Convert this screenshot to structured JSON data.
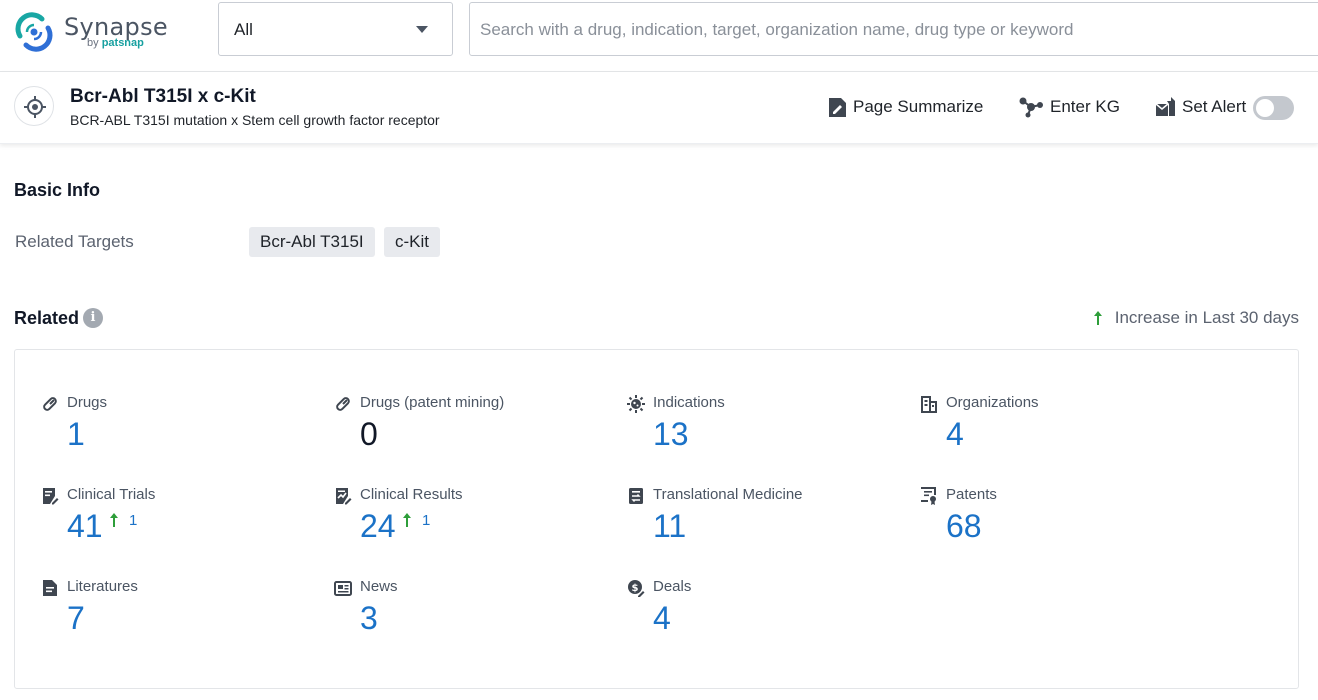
{
  "app": {
    "logo_name": "Synapse",
    "logo_by": "by",
    "logo_brand": "patsnap"
  },
  "search": {
    "scope_value": "All",
    "placeholder": "Search with a drug, indication, target, organization name, drug type or keyword"
  },
  "header": {
    "title": "Bcr-Abl T315I x c-Kit",
    "subtitle": "BCR-ABL T315I mutation x Stem cell growth factor receptor",
    "actions": {
      "summarize": "Page Summarize",
      "kg": "Enter KG",
      "alert": "Set Alert"
    },
    "alert_enabled": false
  },
  "basic_info": {
    "title": "Basic Info",
    "related_targets_label": "Related Targets",
    "targets": [
      "Bcr-Abl T315I",
      "c-Kit"
    ]
  },
  "related": {
    "title": "Related",
    "info_glyph": "i",
    "increase_legend": "Increase in Last 30 days",
    "increase_color": "#2e9e3a",
    "value_color": "#1b72c7",
    "stats": [
      {
        "label": "Drugs",
        "value": "1",
        "icon": "pill-icon"
      },
      {
        "label": "Drugs (patent mining)",
        "value": "0",
        "icon": "pill-icon"
      },
      {
        "label": "Indications",
        "value": "13",
        "icon": "virus-icon"
      },
      {
        "label": "Organizations",
        "value": "4",
        "icon": "building-icon"
      },
      {
        "label": "Clinical Trials",
        "value": "41",
        "increase": "1",
        "icon": "clinical-trial-icon"
      },
      {
        "label": "Clinical Results",
        "value": "24",
        "increase": "1",
        "icon": "clinical-result-icon"
      },
      {
        "label": "Translational Medicine",
        "value": "11",
        "icon": "translational-icon"
      },
      {
        "label": "Patents",
        "value": "68",
        "icon": "patent-icon"
      },
      {
        "label": "Literatures",
        "value": "7",
        "icon": "document-icon"
      },
      {
        "label": "News",
        "value": "3",
        "icon": "news-icon"
      },
      {
        "label": "Deals",
        "value": "4",
        "icon": "deals-icon"
      }
    ]
  }
}
